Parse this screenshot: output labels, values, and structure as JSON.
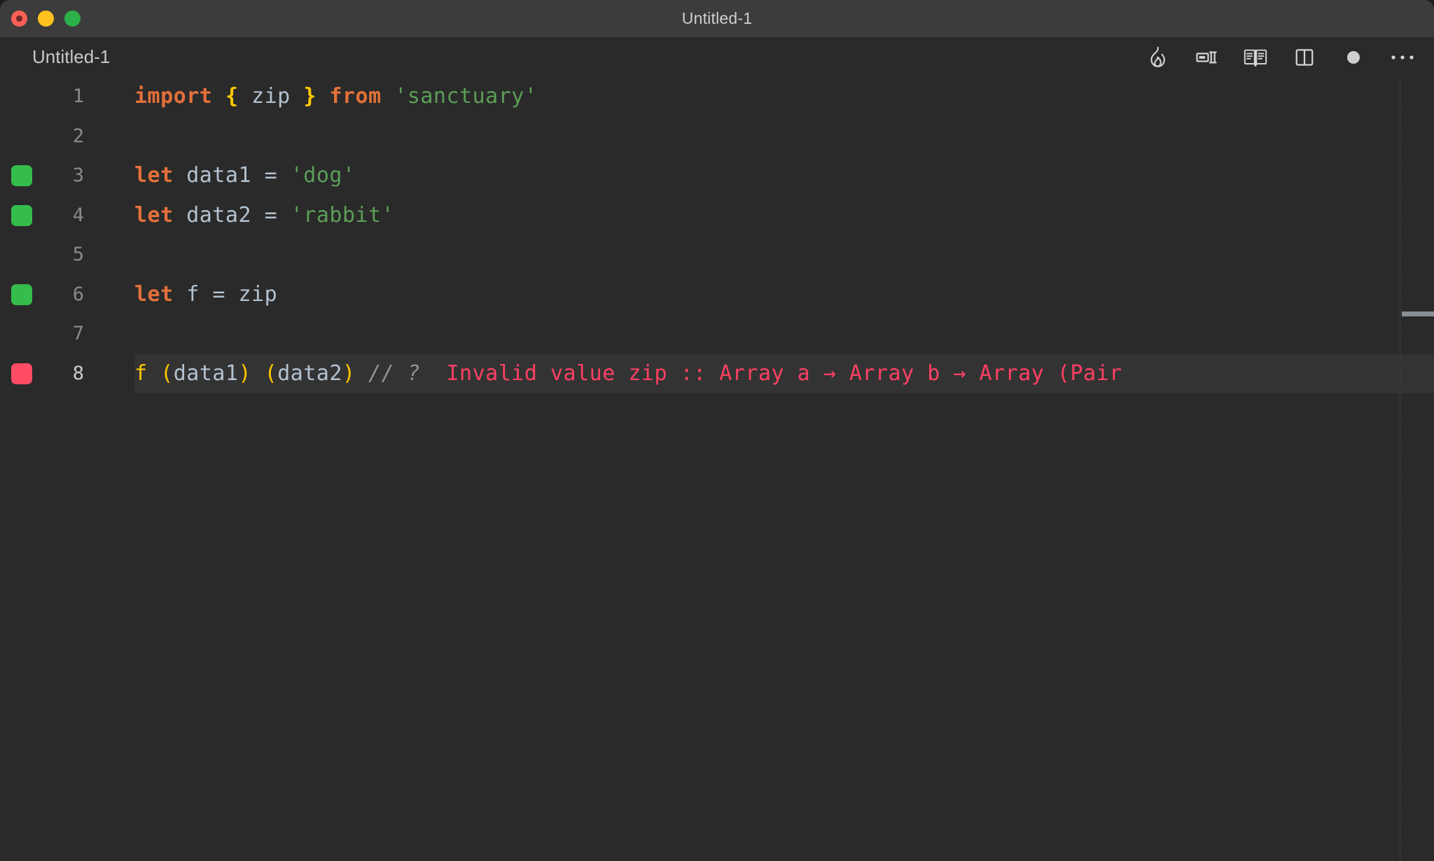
{
  "window": {
    "title": "Untitled-1",
    "traffic_lights": [
      {
        "name": "close",
        "color": "#ff5f57"
      },
      {
        "name": "minimize",
        "color": "#ffc21e"
      },
      {
        "name": "maximize",
        "color": "#2bb14a"
      }
    ]
  },
  "editor": {
    "tab_label": "Untitled-1",
    "toolbar": [
      {
        "icon": "flame-icon",
        "label": "Run / Quokka"
      },
      {
        "icon": "split-editor-right-icon",
        "label": "Split Editor Right"
      },
      {
        "icon": "open-book-icon",
        "label": "Open Preview"
      },
      {
        "icon": "split-panel-icon",
        "label": "Toggle Panel"
      },
      {
        "icon": "dot-icon",
        "label": "Unsaved Changes"
      },
      {
        "icon": "ellipsis-icon",
        "label": "More Actions"
      }
    ],
    "theme": {
      "background": "#2a2a2a",
      "titlebar": "#3c3c3c",
      "active_line": "#333333",
      "keyword": "#e2703a",
      "brace": "#ffc800",
      "variable": "#b3c2d1",
      "string": "#5c9e57",
      "comment": "#8d9298",
      "error": "#ff4064",
      "gutter_ok": "#35bd4c",
      "gutter_error": "#ff4d63"
    },
    "lines": [
      {
        "number": "1",
        "marker": "none",
        "active": false,
        "tokens": [
          {
            "t": "import",
            "c": "tk-kw"
          },
          {
            "t": " ",
            "c": "tk-op"
          },
          {
            "t": "{",
            "c": "tk-brace"
          },
          {
            "t": " ",
            "c": "tk-op"
          },
          {
            "t": "zip",
            "c": "tk-var"
          },
          {
            "t": " ",
            "c": "tk-op"
          },
          {
            "t": "}",
            "c": "tk-brace"
          },
          {
            "t": " ",
            "c": "tk-op"
          },
          {
            "t": "from",
            "c": "tk-kw"
          },
          {
            "t": " ",
            "c": "tk-op"
          },
          {
            "t": "'sanctuary'",
            "c": "tk-str"
          }
        ]
      },
      {
        "number": "2",
        "marker": "none",
        "active": false,
        "tokens": []
      },
      {
        "number": "3",
        "marker": "green",
        "active": false,
        "tokens": [
          {
            "t": "let",
            "c": "tk-kw"
          },
          {
            "t": " data1 ",
            "c": "tk-var"
          },
          {
            "t": "=",
            "c": "tk-op"
          },
          {
            "t": " ",
            "c": "tk-op"
          },
          {
            "t": "'dog'",
            "c": "tk-str"
          }
        ]
      },
      {
        "number": "4",
        "marker": "green",
        "active": false,
        "tokens": [
          {
            "t": "let",
            "c": "tk-kw"
          },
          {
            "t": " data2 ",
            "c": "tk-var"
          },
          {
            "t": "=",
            "c": "tk-op"
          },
          {
            "t": " ",
            "c": "tk-op"
          },
          {
            "t": "'rabbit'",
            "c": "tk-str"
          }
        ]
      },
      {
        "number": "5",
        "marker": "none",
        "active": false,
        "tokens": []
      },
      {
        "number": "6",
        "marker": "green",
        "active": false,
        "tokens": [
          {
            "t": "let",
            "c": "tk-kw"
          },
          {
            "t": " f ",
            "c": "tk-var"
          },
          {
            "t": "=",
            "c": "tk-op"
          },
          {
            "t": " zip",
            "c": "tk-var"
          }
        ]
      },
      {
        "number": "7",
        "marker": "none",
        "active": false,
        "tokens": []
      },
      {
        "number": "8",
        "marker": "red",
        "active": true,
        "tokens": [
          {
            "t": "f",
            "c": "tk-fn"
          },
          {
            "t": " ",
            "c": "tk-op"
          },
          {
            "t": "(",
            "c": "tk-paren"
          },
          {
            "t": "data1",
            "c": "tk-var"
          },
          {
            "t": ")",
            "c": "tk-paren"
          },
          {
            "t": " ",
            "c": "tk-op"
          },
          {
            "t": "(",
            "c": "tk-paren"
          },
          {
            "t": "data2",
            "c": "tk-var"
          },
          {
            "t": ")",
            "c": "tk-paren"
          },
          {
            "t": " ",
            "c": "tk-op"
          },
          {
            "t": "// ?",
            "c": "tk-comment"
          },
          {
            "t": "  Invalid value zip :: Array a → Array b → Array (Pair",
            "c": "tk-error"
          }
        ]
      }
    ]
  }
}
